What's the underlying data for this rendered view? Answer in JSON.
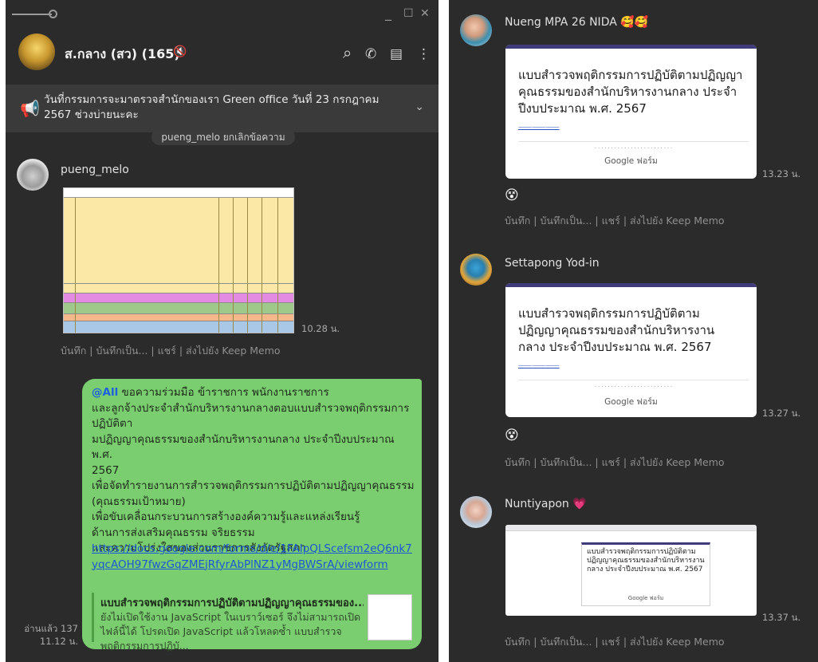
{
  "left": {
    "window": {
      "minimize": "_",
      "maximize": "☐",
      "close": "✕"
    },
    "header": {
      "group_name": "ส.กลาง (สว) (165)",
      "mute_icon": "🔇",
      "search_icon": "⌕",
      "call_icon": "✆",
      "notes_icon": "▤",
      "more_icon": "⋮"
    },
    "announcement": {
      "icon": "📢",
      "text": "วันที่กรรมการจะมาตรวจสำนักของเรา Green office วันที่ 23 กรกฎาคม 2567 ช่วงบ่ายนะคะ",
      "chevron": "⌄"
    },
    "system_note": "pueng_melo ยกเลิกข้อความ",
    "message1": {
      "sender": "pueng_melo",
      "time": "10.28 น.",
      "actions": [
        "บันทึก",
        "บันทึกเป็น...",
        "แชร์",
        "ส่งไปยัง Keep Memo"
      ]
    },
    "message2": {
      "mention": "@All",
      "lines": [
        "ขอความร่วมมือ ข้าราชการ พนักงานราชการ",
        "และลูกจ้างประจำสำนักบริหารงานกลางตอบแบบสำรวจพฤติกรรมการปฏิบัติตา",
        "มปฏิญญาคุณธรรมของสำนักบริหารงานกลาง ประจำปีงบประมาณ พ.ศ.",
        "2567",
        "เพื่อจัดทำรายงานการสำรวจพฤติกรรมการปฏิบัติตามปฏิญญาคุณธรรม",
        "(คุณธรรมเป้าหมาย)",
        "เพื่อขับเคลื่อนกระบวนการสร้างองค์ความรู้และแหล่งเรียนรู้",
        "ด้านการส่งเสริมคุณธรรม จริยธรรม",
        "และความโปร่งใสของส่วนราชการสังกัดรัฐสภา"
      ],
      "link": "https://docs.google.com/forms/d/e/1FAIpQLScefsm2eQ6nk7yqcAOH97fwzGqZMEjRfyrAbPlNZ1yMgBWSrA/viewform",
      "preview_title": "แบบสำรวจพฤติกรรมการปฏิบัติตามปฏิญญาคุณธรรมของ...",
      "preview_desc": "ยังไม่เปิดใช้งาน JavaScript ในเบราว์เซอร์ จึงไม่สามารถเปิดไฟล์นี้ได้ โปรดเปิด JavaScript แล้วโหลดซ้ำ แบบสำรวจพฤติกรรมการปฏิบั...",
      "read_count": "อ่านแล้ว 137",
      "time": "11.12 น."
    }
  },
  "right": {
    "messages": [
      {
        "sender": "Nueng MPA 26 NIDA",
        "sender_emoji": "🥰🥰",
        "form_title": "แบบสำรวจพฤติกรรมการปฏิบัติตามปฏิญญาคุณธรรมของสำนักบริหารงานกลาง ประจำปีงบประมาณ พ.ศ. 2567",
        "brand": "Google ฟอร์ม",
        "time": "13.23 น.",
        "reaction": "😵",
        "actions": [
          "บันทึก",
          "บันทึกเป็น...",
          "แชร์",
          "ส่งไปยัง Keep Memo"
        ]
      },
      {
        "sender": "Settapong Yod-in",
        "form_title": "แบบสำรวจพฤติกรรมการปฏิบัติตามปฏิญญาคุณธรรมของสำนักบริหารงานกลาง ประจำปีงบประมาณ พ.ศ. 2567",
        "brand": "Google ฟอร์ม",
        "time": "13.27 น.",
        "reaction": "😵",
        "actions": [
          "บันทึก",
          "บันทึกเป็น...",
          "แชร์",
          "ส่งไปยัง Keep Memo"
        ]
      },
      {
        "sender": "Nuntiyapon",
        "sender_emoji": "💗",
        "form_title": "แบบสำรวจพฤติกรรมการปฏิบัติตามปฏิญญาคุณธรรมของสำนักบริหารงานกลาง ประจำปีงบประมาณ พ.ศ. 2567",
        "brand": "Google ฟอร์ม",
        "time": "13.37 น.",
        "actions": [
          "บันทึก",
          "บันทึกเป็น...",
          "แชร์",
          "ส่งไปยัง Keep Memo"
        ]
      }
    ]
  },
  "colors": {
    "panel_bg": "#2b2b2b",
    "bubble_green": "#7bce6f",
    "link_blue": "#1b56d8",
    "form_header": "#3f3a7a"
  }
}
